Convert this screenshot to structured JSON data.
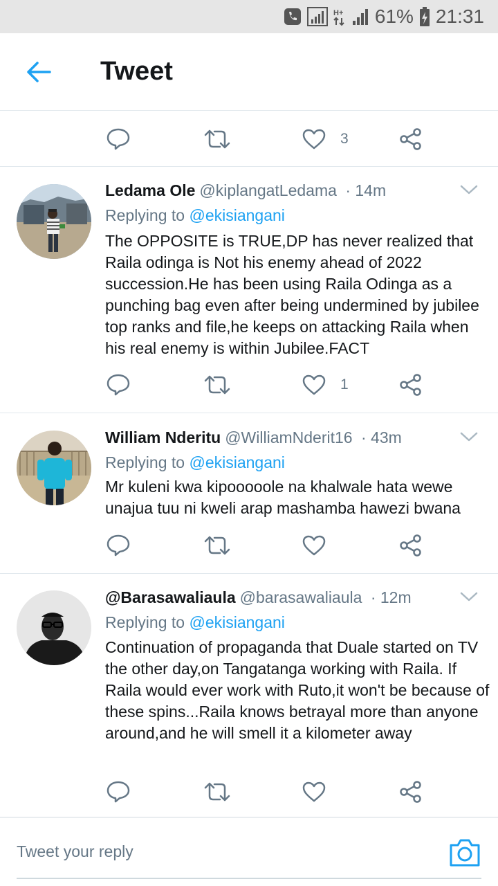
{
  "status_bar": {
    "battery": "61%",
    "time": "21:31"
  },
  "app_bar": {
    "title": "Tweet"
  },
  "top_actions": {
    "like_count": "3"
  },
  "tweets": [
    {
      "name": "Ledama Ole",
      "handle": "@kiplangatLedama",
      "time": "· 14m",
      "replying_label": "Replying to",
      "replying_to": "@ekisiangani",
      "text": "The OPPOSITE is TRUE,DP has never realized that Raila odinga is Not his enemy ahead of 2022 succession.He has been using Raila Odinga as a punching bag even after being undermined by jubilee top ranks and file,he keeps on attacking Raila when his real enemy is within Jubilee.FACT",
      "like_count": "1"
    },
    {
      "name": "William Nderitu",
      "handle": "@WilliamNderit16",
      "time": "· 43m",
      "replying_label": "Replying to",
      "replying_to": "@ekisiangani",
      "text": "Mr  kuleni kwa kipooooole na khalwale hata wewe unajua tuu ni kweli arap mashamba hawezi bwana",
      "like_count": ""
    },
    {
      "name": "@Barasawaliaula",
      "handle": "@barasawaliaula",
      "time": "· 12m",
      "replying_label": "Replying to",
      "replying_to": "@ekisiangani",
      "text": "Continuation of propaganda that Duale started on TV the other day,on Tangatanga working with Raila. If Raila would ever work with Ruto,it won't be because of these spins...Raila knows betrayal more than anyone around,and he will smell it a kilometer away",
      "like_count": ""
    }
  ],
  "compose": {
    "placeholder": "Tweet your reply"
  },
  "colors": {
    "accent": "#1da1f2",
    "icon": "#657786",
    "text": "#14171a"
  }
}
